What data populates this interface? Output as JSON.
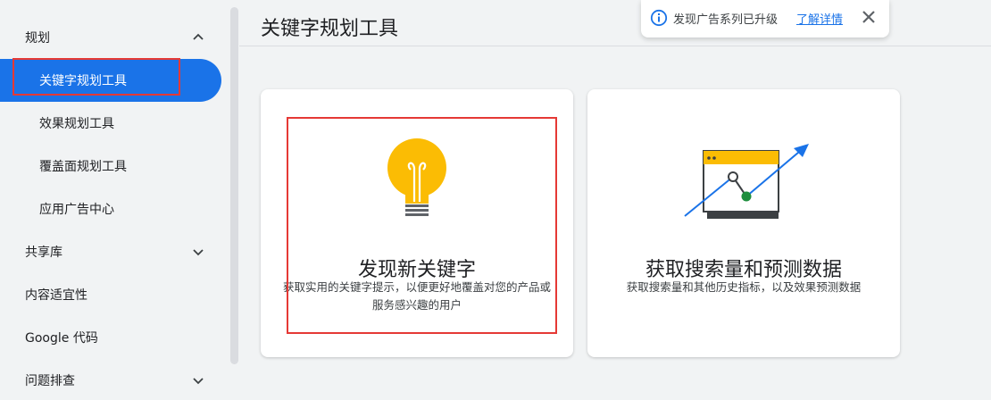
{
  "page": {
    "title": "关键字规划工具"
  },
  "sidebar": {
    "sections": [
      {
        "label": "规划",
        "expanded": true
      },
      {
        "label": "共享库",
        "expanded": false
      },
      {
        "label": "内容适宜性"
      },
      {
        "label": "Google 代码"
      },
      {
        "label": "问题排查",
        "expanded": false
      }
    ],
    "planning_items": [
      {
        "label": "关键字规划工具",
        "active": true
      },
      {
        "label": "效果规划工具"
      },
      {
        "label": "覆盖面规划工具"
      },
      {
        "label": "应用广告中心"
      }
    ]
  },
  "notice": {
    "text": "发现广告系列已升级",
    "link": "了解详情",
    "icon": "info-icon",
    "close_icon": "close-icon"
  },
  "cards": [
    {
      "title": "发现新关键字",
      "description": "获取实用的关键字提示，以便更好地覆盖对您的产品或服务感兴趣的用户",
      "icon": "lightbulb-icon"
    },
    {
      "title": "获取搜索量和预测数据",
      "description": "获取搜索量和其他历史指标，以及效果预测数据",
      "icon": "trend-chart-icon"
    }
  ],
  "colors": {
    "accent": "#1a73e8",
    "highlight_box": "#e53935",
    "bulb": "#fbbc04",
    "green_dot": "#1e8e3e"
  }
}
